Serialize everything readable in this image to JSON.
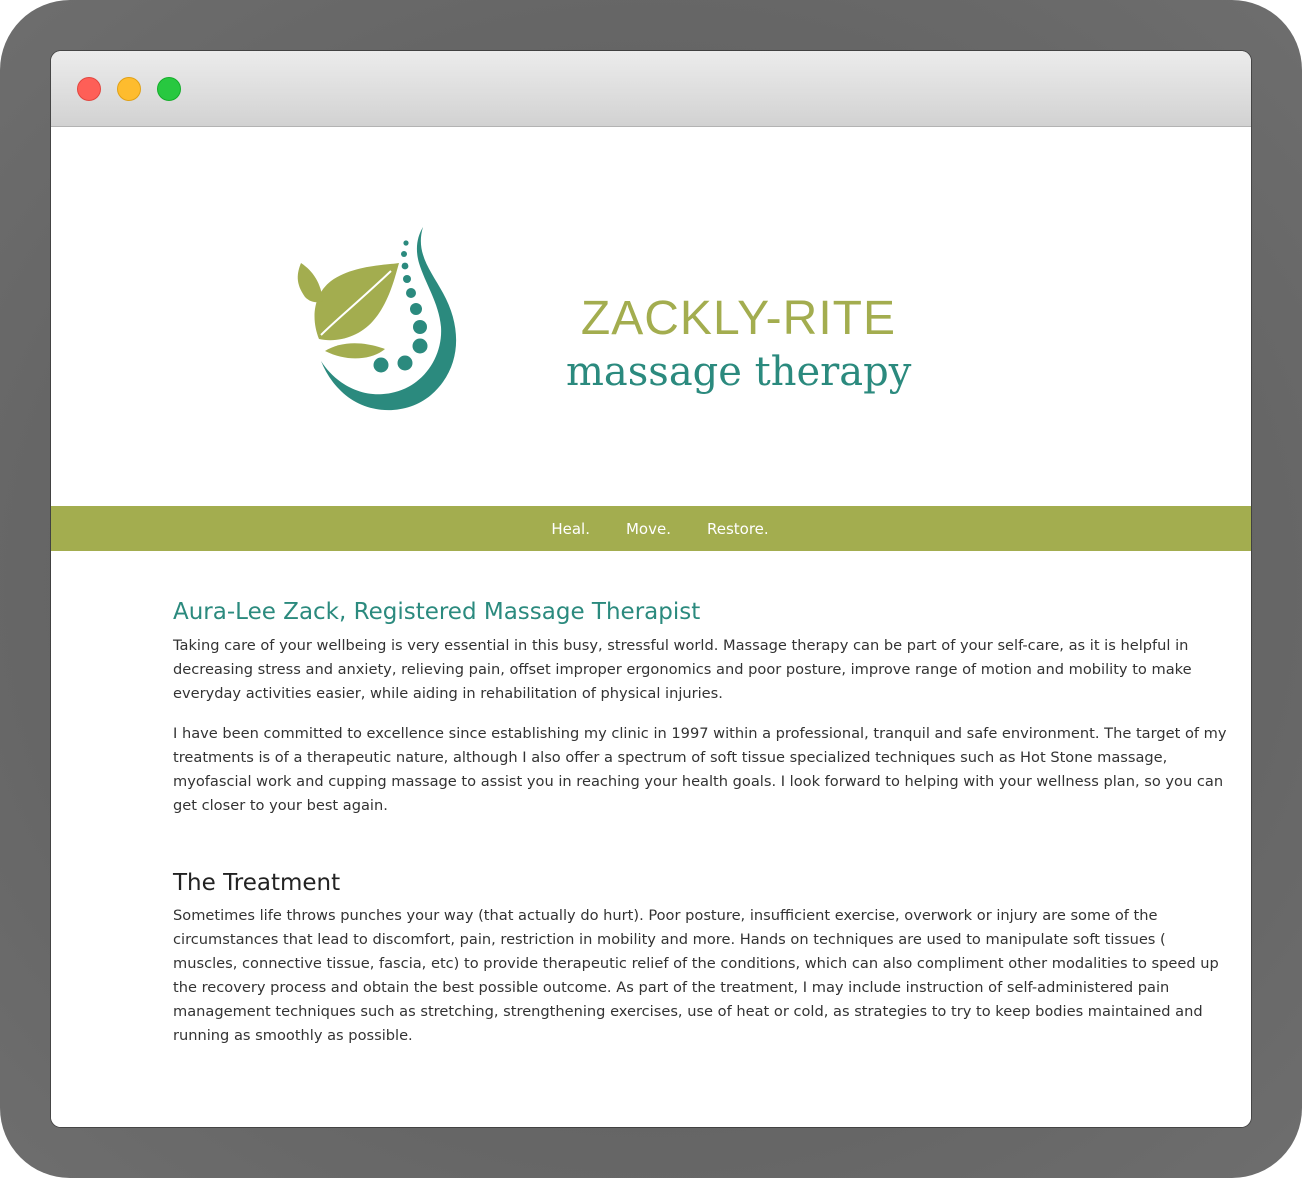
{
  "window": {
    "controls": [
      "close",
      "minimize",
      "maximize"
    ]
  },
  "brand": {
    "name": "ZACKLY-RITE",
    "tagline": "massage therapy",
    "logo_icon": "leaf-spine-drop-icon",
    "colors": {
      "olive": "#a3ad4f",
      "teal": "#2b8a7e"
    }
  },
  "nav": {
    "items": [
      {
        "label": "Heal."
      },
      {
        "label": "Move."
      },
      {
        "label": "Restore."
      }
    ],
    "background": "#a3ad4f"
  },
  "about": {
    "heading": "Aura-Lee Zack, Registered Massage Therapist",
    "paragraphs": [
      "Taking care of your wellbeing is very essential in this busy, stressful world. Massage therapy can be part of your self-care, as it is helpful in decreasing stress and anxiety, relieving pain, offset improper ergonomics and poor posture, improve range of motion and mobility to make everyday activities easier, while aiding in rehabilitation of physical injuries.",
      "I have been committed to excellence since establishing my clinic in 1997 within a professional, tranquil and safe environment. The target of my treatments is of a therapeutic nature, although I also offer a spectrum of soft tissue specialized techniques such as Hot Stone massage, myofascial work and cupping massage to assist you in reaching your health goals. I look forward to helping with your wellness plan, so you can get closer to your best again."
    ]
  },
  "treatment": {
    "heading": "The Treatment",
    "paragraph": "Sometimes life throws punches your way (that actually do hurt). Poor posture, insufficient exercise, overwork or injury are some of the circumstances that lead to discomfort, pain, restriction in mobility and more. Hands on techniques are used to manipulate soft tissues ( muscles, connective tissue, fascia, etc) to provide therapeutic relief of the conditions, which can also compliment other modalities to speed up the recovery process and obtain the best possible outcome. As part of the treatment, I may include instruction of self-administered pain management techniques such as stretching, strengthening exercises, use of heat or cold, as strategies to try to keep bodies maintained and running as smoothly as possible."
  }
}
